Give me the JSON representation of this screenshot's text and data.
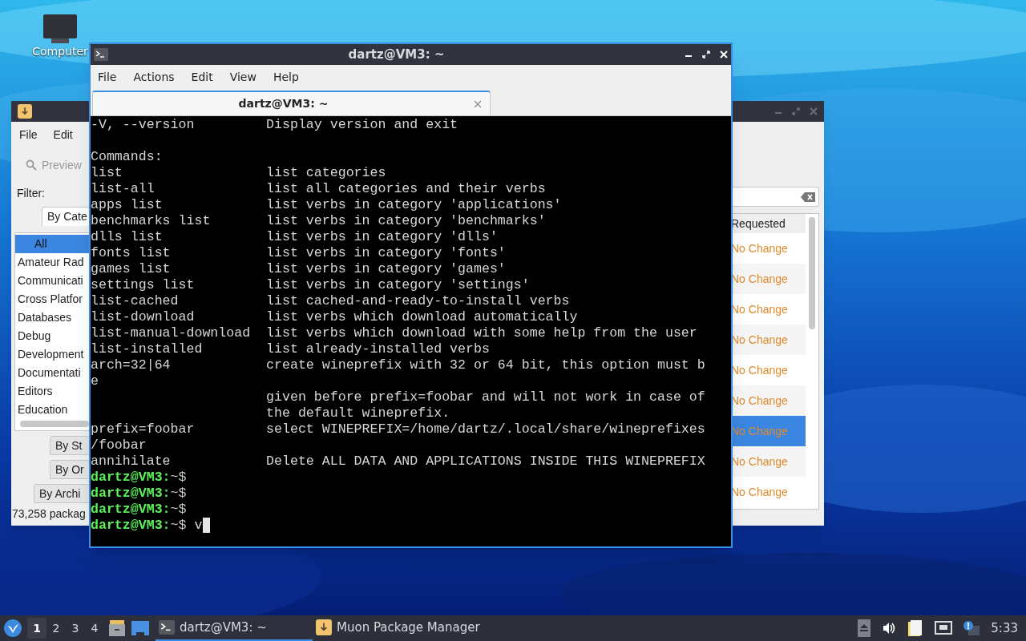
{
  "desktop": {
    "icons": [
      {
        "label": "Computer"
      }
    ]
  },
  "muon": {
    "menu": [
      "File",
      "Edit"
    ],
    "toolbar": {
      "label": "Preview",
      "disabled": true
    },
    "filter_label": "Filter:",
    "filter_tabs": [
      {
        "label": "By Cate",
        "selected": true
      },
      {
        "label": "By St",
        "selected": false
      },
      {
        "label": "By Or",
        "selected": false
      },
      {
        "label": "By Archi",
        "selected": false
      }
    ],
    "categories": [
      {
        "label": "All",
        "selected": true
      },
      {
        "label": "Amateur Rad",
        "selected": false
      },
      {
        "label": "Communicati",
        "selected": false
      },
      {
        "label": "Cross Platfor",
        "selected": false
      },
      {
        "label": "Databases",
        "selected": false
      },
      {
        "label": "Debug",
        "selected": false
      },
      {
        "label": "Development",
        "selected": false
      },
      {
        "label": "Documentati",
        "selected": false
      },
      {
        "label": "Editors",
        "selected": false
      },
      {
        "label": "Education",
        "selected": false
      }
    ],
    "status": "73,258 packag",
    "table": {
      "columns": [
        "Requested"
      ],
      "rows": [
        {
          "requested": "No Change",
          "selected": false
        },
        {
          "requested": "No Change",
          "selected": false
        },
        {
          "requested": "No Change",
          "selected": false
        },
        {
          "requested": "No Change",
          "selected": false
        },
        {
          "requested": "No Change",
          "selected": false
        },
        {
          "requested": "No Change",
          "selected": false
        },
        {
          "requested": "No Change",
          "selected": true
        },
        {
          "requested": "No Change",
          "selected": false
        },
        {
          "requested": "No Change",
          "selected": false
        }
      ]
    }
  },
  "terminal": {
    "title": "dartz@VM3: ~",
    "menu": [
      "File",
      "Actions",
      "Edit",
      "View",
      "Help"
    ],
    "tabs": [
      {
        "label": "dartz@VM3: ~",
        "selected": true
      }
    ],
    "lines": [
      {
        "kind": "row",
        "cmd": "-V, --version",
        "desc": "Display version and exit"
      },
      {
        "kind": "blank"
      },
      {
        "kind": "text",
        "text": "Commands:"
      },
      {
        "kind": "row",
        "cmd": "list",
        "desc": "list categories"
      },
      {
        "kind": "row",
        "cmd": "list-all",
        "desc": "list all categories and their verbs"
      },
      {
        "kind": "row",
        "cmd": "apps list",
        "desc": "list verbs in category 'applications'"
      },
      {
        "kind": "row",
        "cmd": "benchmarks list",
        "desc": "list verbs in category 'benchmarks'"
      },
      {
        "kind": "row",
        "cmd": "dlls list",
        "desc": "list verbs in category 'dlls'"
      },
      {
        "kind": "row",
        "cmd": "fonts list",
        "desc": "list verbs in category 'fonts'"
      },
      {
        "kind": "row",
        "cmd": "games list",
        "desc": "list verbs in category 'games'"
      },
      {
        "kind": "row",
        "cmd": "settings list",
        "desc": "list verbs in category 'settings'"
      },
      {
        "kind": "row",
        "cmd": "list-cached",
        "desc": "list cached-and-ready-to-install verbs"
      },
      {
        "kind": "row",
        "cmd": "list-download",
        "desc": "list verbs which download automatically"
      },
      {
        "kind": "row",
        "cmd": "list-manual-download",
        "desc": "list verbs which download with some help from the user"
      },
      {
        "kind": "row",
        "cmd": "list-installed",
        "desc": "list already-installed verbs"
      },
      {
        "kind": "row",
        "cmd": "arch=32|64",
        "desc": "create wineprefix with 32 or 64 bit, this option must b"
      },
      {
        "kind": "text",
        "text": "e"
      },
      {
        "kind": "row",
        "desc": "given before prefix=foobar and will not work in case of"
      },
      {
        "kind": "row",
        "desc": "the default wineprefix."
      },
      {
        "kind": "row",
        "cmd": "prefix=foobar",
        "desc": "select WINEPREFIX=/home/dartz/.local/share/wineprefixes"
      },
      {
        "kind": "text",
        "text": "/foobar"
      },
      {
        "kind": "row",
        "cmd": "annihilate",
        "desc": "Delete ALL DATA AND APPLICATIONS INSIDE THIS WINEPREFIX"
      },
      {
        "kind": "prompt",
        "user": "dartz@VM3:",
        "path": "~$"
      },
      {
        "kind": "prompt",
        "user": "dartz@VM3:",
        "path": "~$"
      },
      {
        "kind": "prompt",
        "user": "dartz@VM3:",
        "path": "~$"
      },
      {
        "kind": "prompt",
        "user": "dartz@VM3:",
        "path": "~$",
        "input": "v",
        "cursor": true
      }
    ]
  },
  "taskbar": {
    "desktops": [
      {
        "label": "1",
        "selected": true
      },
      {
        "label": "2",
        "selected": false
      },
      {
        "label": "3",
        "selected": false
      },
      {
        "label": "4",
        "selected": false
      }
    ],
    "tasks": [
      {
        "label": "dartz@VM3: ~",
        "kind": "terminal",
        "selected": true
      },
      {
        "label": "Muon Package Manager",
        "kind": "package",
        "selected": false
      }
    ],
    "clock": "5:33"
  }
}
